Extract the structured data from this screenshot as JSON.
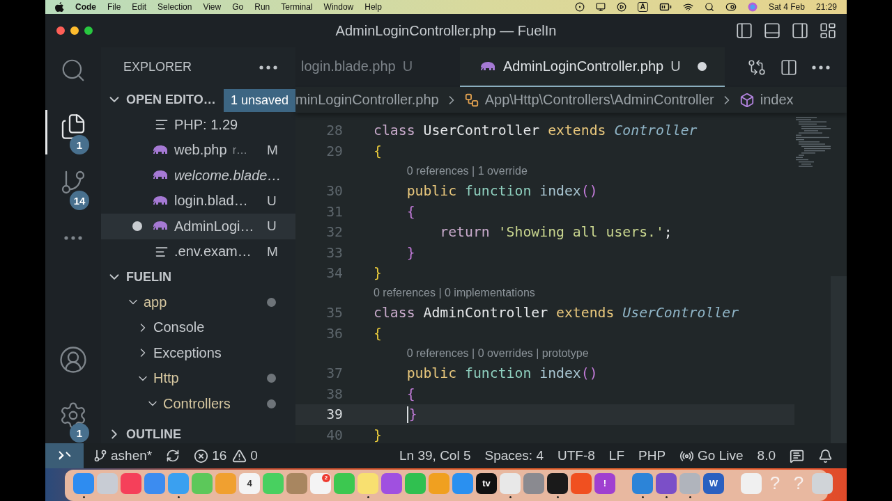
{
  "menubar": {
    "app": "Code",
    "menus": [
      "File",
      "Edit",
      "Selection",
      "View",
      "Go",
      "Run",
      "Terminal",
      "Window",
      "Help"
    ],
    "input_source": "A",
    "date": "Sat 4 Feb",
    "time": "21:29"
  },
  "window": {
    "title": "AdminLoginController.php — FuelIn"
  },
  "activity_bar": {
    "top": [
      {
        "kind": "search",
        "selected": false
      },
      {
        "kind": "explorer",
        "selected": true,
        "badge": "1"
      },
      {
        "kind": "source-control",
        "selected": false,
        "badge": "14"
      },
      {
        "kind": "more",
        "selected": false
      }
    ],
    "bottom": [
      {
        "kind": "account",
        "selected": false
      },
      {
        "kind": "settings",
        "selected": false,
        "badge": "1"
      }
    ]
  },
  "sidebar": {
    "title": "EXPLORER",
    "open_editors": {
      "title": "OPEN EDITO…",
      "expanded": true,
      "badge": "1 unsaved",
      "items": [
        {
          "kind": "lines",
          "label": "PHP: 1.29",
          "preview": false,
          "dirty": false,
          "selected": false
        },
        {
          "kind": "php",
          "label": "web.php",
          "detail": "r…",
          "status": "M",
          "preview": false,
          "dirty": false,
          "selected": false
        },
        {
          "kind": "php",
          "label": "welcome.blade…",
          "preview": true,
          "dirty": false,
          "selected": false
        },
        {
          "kind": "php",
          "label": "login.blad…",
          "status": "U",
          "preview": false,
          "dirty": false,
          "selected": false
        },
        {
          "kind": "php",
          "label": "AdminLogi…",
          "status": "U",
          "preview": false,
          "dirty": true,
          "selected": true
        },
        {
          "kind": "lines",
          "label": ".env.exam…",
          "status": "M",
          "preview": false,
          "dirty": false,
          "selected": false
        }
      ]
    },
    "folder": {
      "title": "FUELIN",
      "expanded": true,
      "children": [
        {
          "label": "app",
          "expanded": true,
          "modified": true,
          "children": [
            {
              "label": "Console",
              "expanded": false,
              "modified": false
            },
            {
              "label": "Exceptions",
              "expanded": false,
              "modified": false
            },
            {
              "label": "Http",
              "expanded": true,
              "modified": true,
              "children": [
                {
                  "label": "Controllers",
                  "expanded": true,
                  "modified": true
                }
              ]
            }
          ]
        }
      ]
    },
    "outline": {
      "title": "OUTLINE",
      "expanded": false
    }
  },
  "editor": {
    "tabs": [
      {
        "label": "login.blade.php",
        "status": "U",
        "kind": "plain",
        "selected": false,
        "dirty": false
      },
      {
        "label": "AdminLoginController.php",
        "status": "U",
        "kind": "php",
        "selected": true,
        "dirty": true
      }
    ],
    "breadcrumbs": [
      {
        "kind": "file",
        "label": "minLoginController.php"
      },
      {
        "kind": "namespace",
        "label": "App\\Http\\Controllers\\AdminController"
      },
      {
        "kind": "method",
        "label": "index"
      }
    ],
    "lines": [
      {
        "kind": "code",
        "number": "28",
        "current": false,
        "tokens": [
          {
            "text": "class",
            "kind": "keyword"
          },
          {
            "text": " UserController",
            "kind": "name"
          },
          {
            "text": " extends",
            "kind": "modifier"
          },
          {
            "text": " Controller",
            "kind": "type"
          }
        ]
      },
      {
        "kind": "code",
        "number": "29",
        "current": false,
        "tokens": [
          {
            "text": "{",
            "kind": "brace1"
          }
        ]
      },
      {
        "kind": "lens",
        "text": "    0 references | 1 override"
      },
      {
        "kind": "code",
        "number": "30",
        "current": false,
        "tokens": [
          {
            "text": "    public",
            "kind": "modifier"
          },
          {
            "text": " function",
            "kind": "function"
          },
          {
            "text": " index",
            "kind": "fname"
          },
          {
            "text": "()",
            "kind": "brace2"
          }
        ]
      },
      {
        "kind": "code",
        "number": "31",
        "current": false,
        "tokens": [
          {
            "text": "    {",
            "kind": "brace2"
          }
        ]
      },
      {
        "kind": "code",
        "number": "32",
        "current": false,
        "tokens": [
          {
            "text": "        return",
            "kind": "keyword"
          },
          {
            "text": " 'Showing all users.'",
            "kind": "string"
          },
          {
            "text": ";",
            "kind": "name"
          }
        ]
      },
      {
        "kind": "code",
        "number": "33",
        "current": false,
        "tokens": [
          {
            "text": "    }",
            "kind": "brace2"
          }
        ]
      },
      {
        "kind": "code",
        "number": "34",
        "current": false,
        "tokens": [
          {
            "text": "}",
            "kind": "brace1"
          }
        ]
      },
      {
        "kind": "lens",
        "text": "0 references | 0 implementations"
      },
      {
        "kind": "code",
        "number": "35",
        "current": false,
        "tokens": [
          {
            "text": "class",
            "kind": "keyword"
          },
          {
            "text": " AdminController",
            "kind": "name"
          },
          {
            "text": " extends",
            "kind": "modifier"
          },
          {
            "text": " UserController",
            "kind": "type"
          }
        ]
      },
      {
        "kind": "code",
        "number": "36",
        "current": false,
        "tokens": [
          {
            "text": "{",
            "kind": "brace1"
          }
        ]
      },
      {
        "kind": "lens",
        "text": "    0 references | 0 overrides | prototype"
      },
      {
        "kind": "code",
        "number": "37",
        "current": false,
        "tokens": [
          {
            "text": "    public",
            "kind": "modifier"
          },
          {
            "text": " function",
            "kind": "function"
          },
          {
            "text": " index",
            "kind": "fname"
          },
          {
            "text": "()",
            "kind": "brace2"
          }
        ]
      },
      {
        "kind": "code",
        "number": "38",
        "current": false,
        "tokens": [
          {
            "text": "    {",
            "kind": "brace2"
          }
        ]
      },
      {
        "kind": "code",
        "number": "39",
        "current": true,
        "tokens": [
          {
            "text": "    }",
            "kind": "brace2"
          }
        ]
      },
      {
        "kind": "code",
        "number": "40",
        "current": false,
        "tokens": [
          {
            "text": "}",
            "kind": "brace1"
          }
        ]
      }
    ]
  },
  "status_bar": {
    "left": [
      {
        "kind": "remote"
      },
      {
        "kind": "branch",
        "label": "ashen*"
      },
      {
        "kind": "sync"
      },
      {
        "kind": "errors",
        "label": "16"
      },
      {
        "kind": "warnings",
        "label": "0"
      }
    ],
    "right": [
      {
        "kind": "text",
        "label": "Ln 39, Col 5"
      },
      {
        "kind": "text",
        "label": "Spaces: 4"
      },
      {
        "kind": "text",
        "label": "UTF-8"
      },
      {
        "kind": "text",
        "label": "LF"
      },
      {
        "kind": "text",
        "label": "PHP"
      },
      {
        "kind": "golive",
        "label": "Go Live"
      },
      {
        "kind": "text",
        "label": "8.0"
      },
      {
        "kind": "feedback"
      },
      {
        "kind": "bell"
      }
    ]
  },
  "dock": {
    "items": [
      {
        "kind": "app",
        "color": "#2e8cf0",
        "running": true
      },
      {
        "kind": "app",
        "color": "#c8ccd4",
        "running": false
      },
      {
        "kind": "app",
        "color": "#f5405a",
        "running": false
      },
      {
        "kind": "app",
        "color": "#3c8cf0",
        "running": false
      },
      {
        "kind": "app",
        "color": "#3aa0f0",
        "running": true
      },
      {
        "kind": "app",
        "color": "#5cc85a",
        "running": false
      },
      {
        "kind": "app",
        "color": "#f0a030",
        "running": false
      },
      {
        "kind": "app",
        "color": "#f4f4f4",
        "text": "4",
        "running": false
      },
      {
        "kind": "app",
        "color": "#48d060",
        "running": false
      },
      {
        "kind": "app",
        "color": "#a88660",
        "running": false
      },
      {
        "kind": "app",
        "color": "#f4f4f4",
        "badge": "2",
        "running": false
      },
      {
        "kind": "app",
        "color": "#3cc850",
        "running": false
      },
      {
        "kind": "app",
        "color": "#f8e070",
        "running": true
      },
      {
        "kind": "app",
        "color": "#a050e0",
        "running": false
      },
      {
        "kind": "app",
        "color": "#30c050",
        "running": false
      },
      {
        "kind": "app",
        "color": "#f0a020",
        "running": false
      },
      {
        "kind": "app",
        "color": "#2a90f0",
        "running": false
      },
      {
        "kind": "app",
        "color": "#111111",
        "text": "tv",
        "running": false
      },
      {
        "kind": "app",
        "color": "#e8e8e8",
        "running": true
      },
      {
        "kind": "app",
        "color": "#8a8a90",
        "running": false
      },
      {
        "kind": "app",
        "color": "#1a1a1a",
        "running": true
      },
      {
        "kind": "app",
        "color": "#f05020",
        "running": false
      },
      {
        "kind": "app",
        "color": "#a040d0",
        "text": "!",
        "running": false
      },
      {
        "kind": "separator"
      },
      {
        "kind": "app",
        "color": "#2c84d8",
        "running": true
      },
      {
        "kind": "app",
        "color": "#7b4fc8",
        "running": true
      },
      {
        "kind": "app",
        "color": "#b0b4bc",
        "running": true
      },
      {
        "kind": "app",
        "color": "#2b60c0",
        "text": "W",
        "running": false
      },
      {
        "kind": "separator"
      },
      {
        "kind": "app",
        "color": "#f0f0f0",
        "running": false
      },
      {
        "kind": "missing",
        "text": "?",
        "running": false
      },
      {
        "kind": "missing",
        "text": "?",
        "running": false
      },
      {
        "kind": "app",
        "color": "#d0d4d8",
        "running": false
      }
    ]
  }
}
